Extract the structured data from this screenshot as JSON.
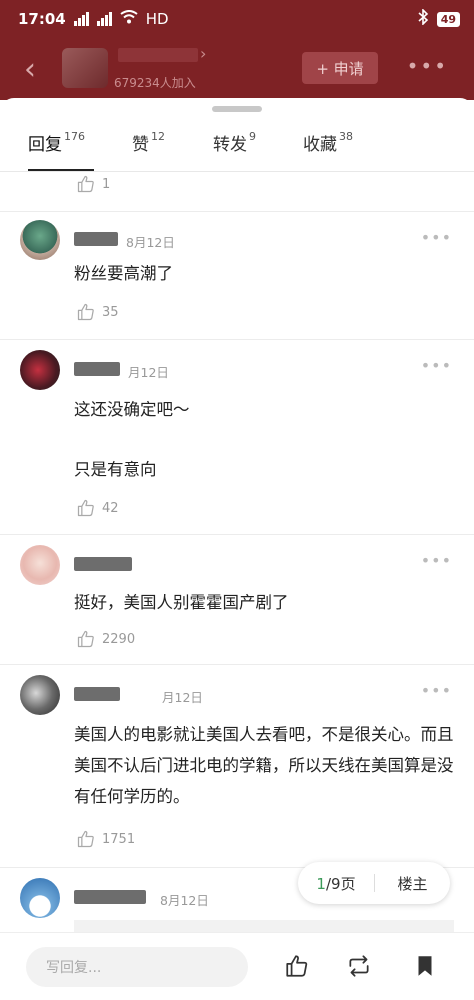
{
  "status_bar": {
    "time": "17:04",
    "network": "HD",
    "battery": "49"
  },
  "header": {
    "members": "679234人加入",
    "apply_label": "+ 申请",
    "more": "•••"
  },
  "tabs": [
    {
      "label": "回复",
      "count": "176"
    },
    {
      "label": "赞",
      "count": "12"
    },
    {
      "label": "转发",
      "count": "9"
    },
    {
      "label": "收藏",
      "count": "38"
    }
  ],
  "comments": [
    {
      "likes": "1"
    },
    {
      "date": "8月12日",
      "text": "粉丝要高潮了",
      "likes": "35"
    },
    {
      "date": "月12日",
      "text_line1": "这还没确定吧～",
      "text_line2": "只是有意向",
      "likes": "42"
    },
    {
      "date": "",
      "text": "挺好，美国人别霍霍国产剧了",
      "likes": "2290"
    },
    {
      "date": "月12日",
      "text": "美国人的电影就让美国人去看吧，不是很关心。而且美国不认后门进北电的学籍，所以天线在美国算是没有任何学历的。",
      "likes": "1751"
    },
    {
      "date": "8月12日"
    }
  ],
  "pager": {
    "current": "1",
    "total_suffix": "/9页",
    "host_label": "楼主"
  },
  "bottom_bar": {
    "reply_placeholder": "写回复..."
  },
  "colors": {
    "header_bg": "#7e2225",
    "pager_current": "#3c9a5a"
  }
}
